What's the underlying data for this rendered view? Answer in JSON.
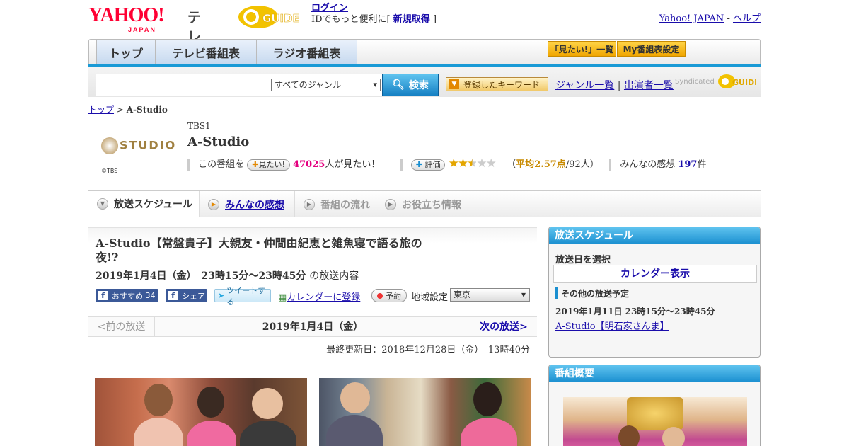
{
  "header": {
    "logo_text": "YAHOO!",
    "logo_sub": "JAPAN",
    "service_name": "テレビ",
    "gguide_logo": "GUIDE",
    "login": "ログイン",
    "login_note": "IDでもっと便利に[",
    "register": "新規取得",
    "login_note_end": "]",
    "yahoo_japan": "Yahoo! JAPAN",
    "sep": "-",
    "help": "ヘルプ"
  },
  "nav": {
    "tabs": [
      "トップ",
      "テレビ番組表",
      "ラジオ番組表"
    ],
    "mitai_list": "「見たい!」一覧",
    "my_schedule": "My番組表設定"
  },
  "search": {
    "genre": "すべてのジャンル",
    "button": "検索",
    "keywords": "登録したキーワード",
    "genre_list": "ジャンル一覧",
    "divider": "|",
    "performers": "出演者一覧",
    "syndicated": "Syndicated"
  },
  "breadcrumb": {
    "top": "トップ",
    "sep": ">",
    "current": "A-Studio"
  },
  "program": {
    "logo_text": "STUDIO",
    "copyright": "©TBS",
    "channel": "TBS1",
    "title": "A-Studio",
    "want_prefix": "この番組を",
    "want_button": "見たい!",
    "want_count": "47025",
    "want_suffix": "人が見たい！",
    "rate_button": "評価",
    "rating": 2.57,
    "rating_open": "（",
    "rating_label": "平均2.57点",
    "rating_count": "/92人）",
    "impressions_label": "みんなの感想",
    "impressions_count": "197",
    "impressions_unit": "件"
  },
  "subtabs": [
    "放送スケジュール",
    "みんなの感想",
    "番組の流れ",
    "お役立ち情報"
  ],
  "episode": {
    "title": "A-Studio【常盤貴子】大親友・仲間由紀恵と雑魚寝で語る旅の夜!?",
    "date": "2019年1月4日（金）　23時15分～23時45分",
    "date_suffix": "の放送内容",
    "fb_recommend": "おすすめ",
    "fb_count": "34",
    "fb_share": "シェア",
    "tweet": "ツイートする",
    "calendar": "カレンダーに登録",
    "reserve": "予約",
    "region_label": "地域設定",
    "region": "東京"
  },
  "pager": {
    "prev": "<前の放送",
    "current": "2019年1月4日（金）",
    "next": "次の放送>"
  },
  "updated": "最終更新日：2018年12月28日（金）　13時40分",
  "sidebar": {
    "schedule_title": "放送スケジュール",
    "pick_date": "放送日を選択",
    "calendar": "カレンダー表示",
    "other": "その他の放送予定",
    "other_date": "2019年1月11日  23時15分～23時45分",
    "other_title": "A-Studio【明石家さんま】",
    "overview_title": "番組概要"
  },
  "colors": {
    "accent_blue": "#1a9ad6",
    "pink": "#e4007f",
    "gold": "#c88a00"
  }
}
